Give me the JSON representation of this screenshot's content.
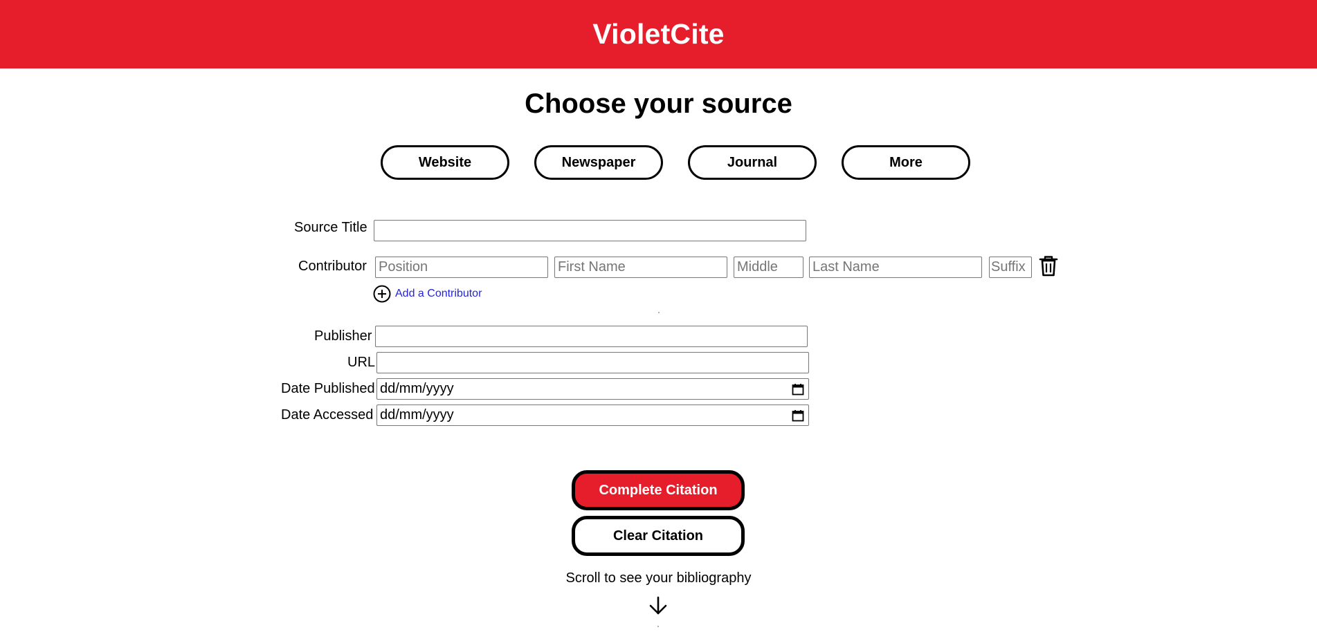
{
  "header": {
    "brand": "VioletCite"
  },
  "main": {
    "title": "Choose your source",
    "source_tabs": [
      "Website",
      "Newspaper",
      "Journal",
      "More"
    ]
  },
  "form": {
    "source_title_label": "Source Title",
    "contributor_label": "Contributor",
    "contributor_placeholders": {
      "position": "Position",
      "first_name": "First Name",
      "middle": "Middle",
      "last_name": "Last Name",
      "suffix": "Suffix"
    },
    "add_contributor_label": "Add a Contributor",
    "publisher_label": "Publisher",
    "url_label": "URL",
    "date_published_label": "Date Published",
    "date_accessed_label": "Date Accessed",
    "date_placeholder": "dd/mm/yyyy"
  },
  "actions": {
    "complete_label": "Complete Citation",
    "clear_label": "Clear Citation",
    "scroll_hint": "Scroll to see your bibliography"
  },
  "icons": {
    "trash": "trash-icon",
    "add": "plus-circle-icon",
    "calendar": "calendar-icon",
    "arrow": "arrow-down-icon"
  },
  "colors": {
    "brand_red": "#e61e2b",
    "link_blue": "#2424d6"
  }
}
